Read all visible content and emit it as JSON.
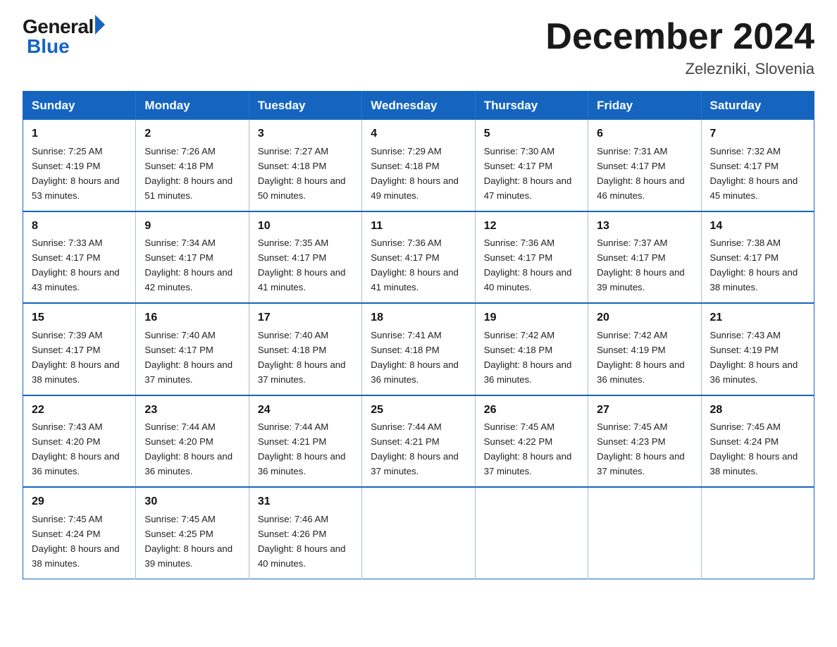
{
  "logo": {
    "text_general": "General",
    "text_blue": "Blue"
  },
  "title": "December 2024",
  "location": "Zelezniki, Slovenia",
  "days_of_week": [
    "Sunday",
    "Monday",
    "Tuesday",
    "Wednesday",
    "Thursday",
    "Friday",
    "Saturday"
  ],
  "weeks": [
    [
      {
        "day": "1",
        "sunrise": "7:25 AM",
        "sunset": "4:19 PM",
        "daylight": "8 hours and 53 minutes."
      },
      {
        "day": "2",
        "sunrise": "7:26 AM",
        "sunset": "4:18 PM",
        "daylight": "8 hours and 51 minutes."
      },
      {
        "day": "3",
        "sunrise": "7:27 AM",
        "sunset": "4:18 PM",
        "daylight": "8 hours and 50 minutes."
      },
      {
        "day": "4",
        "sunrise": "7:29 AM",
        "sunset": "4:18 PM",
        "daylight": "8 hours and 49 minutes."
      },
      {
        "day": "5",
        "sunrise": "7:30 AM",
        "sunset": "4:17 PM",
        "daylight": "8 hours and 47 minutes."
      },
      {
        "day": "6",
        "sunrise": "7:31 AM",
        "sunset": "4:17 PM",
        "daylight": "8 hours and 46 minutes."
      },
      {
        "day": "7",
        "sunrise": "7:32 AM",
        "sunset": "4:17 PM",
        "daylight": "8 hours and 45 minutes."
      }
    ],
    [
      {
        "day": "8",
        "sunrise": "7:33 AM",
        "sunset": "4:17 PM",
        "daylight": "8 hours and 43 minutes."
      },
      {
        "day": "9",
        "sunrise": "7:34 AM",
        "sunset": "4:17 PM",
        "daylight": "8 hours and 42 minutes."
      },
      {
        "day": "10",
        "sunrise": "7:35 AM",
        "sunset": "4:17 PM",
        "daylight": "8 hours and 41 minutes."
      },
      {
        "day": "11",
        "sunrise": "7:36 AM",
        "sunset": "4:17 PM",
        "daylight": "8 hours and 41 minutes."
      },
      {
        "day": "12",
        "sunrise": "7:36 AM",
        "sunset": "4:17 PM",
        "daylight": "8 hours and 40 minutes."
      },
      {
        "day": "13",
        "sunrise": "7:37 AM",
        "sunset": "4:17 PM",
        "daylight": "8 hours and 39 minutes."
      },
      {
        "day": "14",
        "sunrise": "7:38 AM",
        "sunset": "4:17 PM",
        "daylight": "8 hours and 38 minutes."
      }
    ],
    [
      {
        "day": "15",
        "sunrise": "7:39 AM",
        "sunset": "4:17 PM",
        "daylight": "8 hours and 38 minutes."
      },
      {
        "day": "16",
        "sunrise": "7:40 AM",
        "sunset": "4:17 PM",
        "daylight": "8 hours and 37 minutes."
      },
      {
        "day": "17",
        "sunrise": "7:40 AM",
        "sunset": "4:18 PM",
        "daylight": "8 hours and 37 minutes."
      },
      {
        "day": "18",
        "sunrise": "7:41 AM",
        "sunset": "4:18 PM",
        "daylight": "8 hours and 36 minutes."
      },
      {
        "day": "19",
        "sunrise": "7:42 AM",
        "sunset": "4:18 PM",
        "daylight": "8 hours and 36 minutes."
      },
      {
        "day": "20",
        "sunrise": "7:42 AM",
        "sunset": "4:19 PM",
        "daylight": "8 hours and 36 minutes."
      },
      {
        "day": "21",
        "sunrise": "7:43 AM",
        "sunset": "4:19 PM",
        "daylight": "8 hours and 36 minutes."
      }
    ],
    [
      {
        "day": "22",
        "sunrise": "7:43 AM",
        "sunset": "4:20 PM",
        "daylight": "8 hours and 36 minutes."
      },
      {
        "day": "23",
        "sunrise": "7:44 AM",
        "sunset": "4:20 PM",
        "daylight": "8 hours and 36 minutes."
      },
      {
        "day": "24",
        "sunrise": "7:44 AM",
        "sunset": "4:21 PM",
        "daylight": "8 hours and 36 minutes."
      },
      {
        "day": "25",
        "sunrise": "7:44 AM",
        "sunset": "4:21 PM",
        "daylight": "8 hours and 37 minutes."
      },
      {
        "day": "26",
        "sunrise": "7:45 AM",
        "sunset": "4:22 PM",
        "daylight": "8 hours and 37 minutes."
      },
      {
        "day": "27",
        "sunrise": "7:45 AM",
        "sunset": "4:23 PM",
        "daylight": "8 hours and 37 minutes."
      },
      {
        "day": "28",
        "sunrise": "7:45 AM",
        "sunset": "4:24 PM",
        "daylight": "8 hours and 38 minutes."
      }
    ],
    [
      {
        "day": "29",
        "sunrise": "7:45 AM",
        "sunset": "4:24 PM",
        "daylight": "8 hours and 38 minutes."
      },
      {
        "day": "30",
        "sunrise": "7:45 AM",
        "sunset": "4:25 PM",
        "daylight": "8 hours and 39 minutes."
      },
      {
        "day": "31",
        "sunrise": "7:46 AM",
        "sunset": "4:26 PM",
        "daylight": "8 hours and 40 minutes."
      },
      null,
      null,
      null,
      null
    ]
  ]
}
